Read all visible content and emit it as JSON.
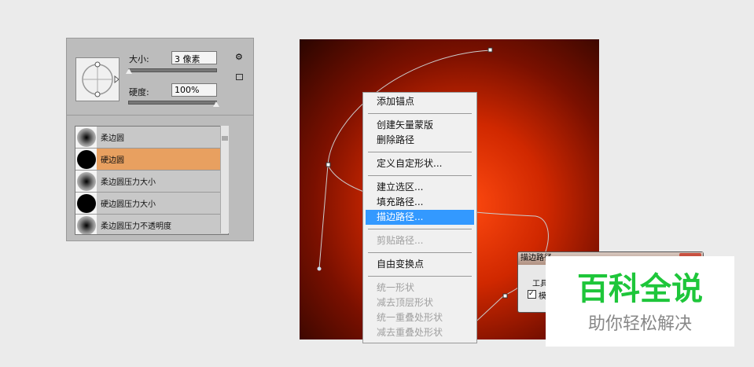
{
  "brush_panel": {
    "size_label": "大小:",
    "size_value": "3 像素",
    "hardness_label": "硬度:",
    "hardness_value": "100%",
    "size_slider": 0.0,
    "hardness_slider": 1.0,
    "presets": [
      {
        "name": "柔边圆",
        "type": "soft"
      },
      {
        "name": "硬边圆",
        "type": "hard",
        "selected": true
      },
      {
        "name": "柔边圆压力大小",
        "type": "soft"
      },
      {
        "name": "硬边圆压力大小",
        "type": "hard"
      },
      {
        "name": "柔边圆压力不透明度",
        "type": "soft"
      }
    ]
  },
  "context_menu": {
    "groups": [
      [
        {
          "label": "添加锚点"
        }
      ],
      [
        {
          "label": "创建矢量蒙版"
        },
        {
          "label": "删除路径"
        }
      ],
      [
        {
          "label": "定义自定形状..."
        }
      ],
      [
        {
          "label": "建立选区..."
        },
        {
          "label": "填充路径..."
        },
        {
          "label": "描边路径...",
          "highlighted": true
        }
      ],
      [
        {
          "label": "剪贴路径...",
          "disabled": true
        }
      ],
      [
        {
          "label": "自由变换点"
        }
      ],
      [
        {
          "label": "统一形状",
          "disabled": true
        },
        {
          "label": "减去顶层形状",
          "disabled": true
        },
        {
          "label": "统一重叠处形状",
          "disabled": true
        },
        {
          "label": "减去重叠处形状",
          "disabled": true
        }
      ]
    ]
  },
  "dialog": {
    "title": "描边路径",
    "tool_label": "工具:",
    "checkbox_label": "模"
  },
  "watermark": {
    "title": "百科全说",
    "subtitle": "助你轻松解决"
  },
  "colors": {
    "accent": "#3399ff",
    "selected": "#e8a060",
    "brand": "#1ec63a"
  }
}
